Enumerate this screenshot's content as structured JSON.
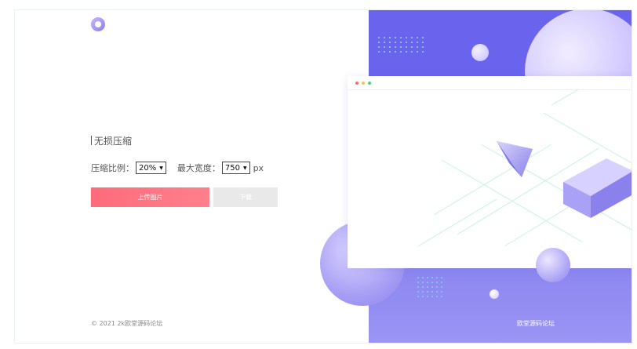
{
  "brand": {
    "logo_name": "logo-circle"
  },
  "main": {
    "title": "无损压缩",
    "ratio_label": "压缩比例：",
    "ratio_value": "20%",
    "width_label": "最大宽度：",
    "width_value": "750",
    "unit": "px",
    "upload_label": "上传图片",
    "download_label": "下载"
  },
  "footer": {
    "copyright": "© 2021 2k欧堂源码论坛",
    "right_text": "欧堂源码论坛"
  },
  "colors": {
    "accent_red": "#ff6b7b",
    "purple": "#6a63ee",
    "button_disabled": "#e9e9e9"
  },
  "window": {
    "dots": [
      "#ff6a6a",
      "#ffc34d",
      "#4fd17d"
    ]
  }
}
